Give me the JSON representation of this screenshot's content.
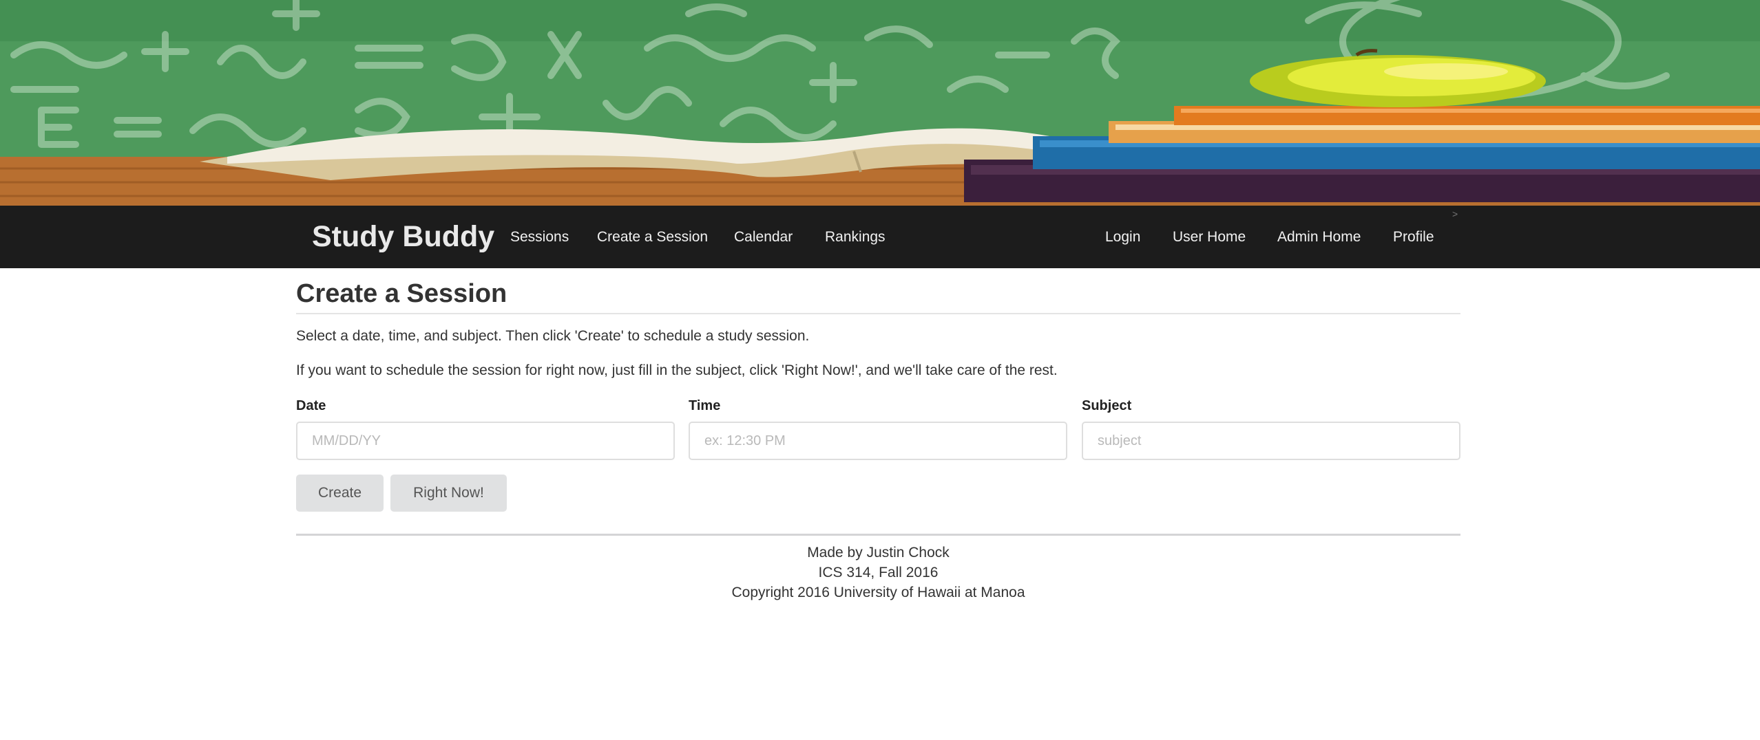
{
  "nav": {
    "brand": "Study Buddy",
    "left_links": [
      "Sessions",
      "Create a Session",
      "Calendar",
      "Rankings"
    ],
    "right_links": [
      "Login",
      "User Home",
      "Admin Home",
      "Profile"
    ],
    "caret": ">"
  },
  "main": {
    "title": "Create a Session",
    "instructions": [
      "Select a date, time, and subject. Then click 'Create' to schedule a study session.",
      "If you want to schedule the session for right now, just fill in the subject, click 'Right Now!', and we'll take care of the rest."
    ],
    "fields": [
      {
        "label": "Date",
        "placeholder": "MM/DD/YY",
        "value": ""
      },
      {
        "label": "Time",
        "placeholder": "ex: 12:30 PM",
        "value": ""
      },
      {
        "label": "Subject",
        "placeholder": "subject",
        "value": ""
      }
    ],
    "buttons": {
      "create": "Create",
      "right_now": "Right Now!"
    }
  },
  "footer": {
    "lines": [
      "Made by Justin Chock",
      "ICS 314, Fall 2016",
      "Copyright 2016 University of Hawaii at Manoa"
    ]
  }
}
